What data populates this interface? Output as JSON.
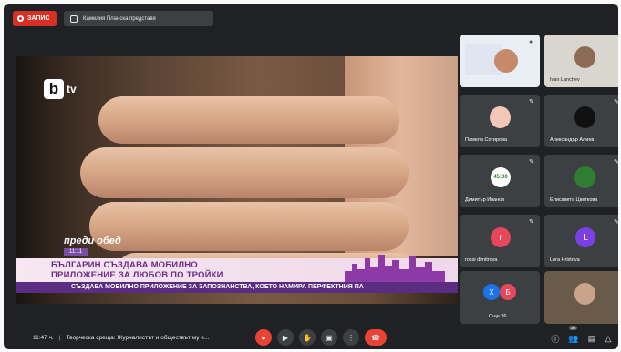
{
  "topbar": {
    "record_label": "ЗАПИС",
    "presenter_chip": "Камелия Планска представя"
  },
  "stage": {
    "channel_logo": "b",
    "channel_suffix": "tv",
    "show_name": "преди обед",
    "time_tag": "11:11",
    "headline_line1": "БЪЛГАРИН СЪЗДАВА МОБИЛНО",
    "headline_line2": "ПРИЛОЖЕНИЕ ЗА ЛЮБОВ ПО ТРОЙКИ",
    "ticker": "СЪЗДАВА МОБИЛНО ПРИЛОЖЕНИЕ ЗА ЗАПОЗНАНСТВА, КОЕТО НАМИРА ПЕРФЕКТНИЯ ПА"
  },
  "participants": [
    {
      "name": "",
      "kind": "screen"
    },
    {
      "name": "Ivan Lanchev",
      "kind": "photo"
    },
    {
      "name": "Памела Сотирова",
      "kind": "photo",
      "color": "#f2c6b8"
    },
    {
      "name": "Александър Алиев",
      "kind": "photo",
      "color": "#111111"
    },
    {
      "name": "Димитър Иванов",
      "kind": "badge",
      "label": "45:00",
      "color": "#ffffff"
    },
    {
      "name": "Елисавета Цветкова",
      "kind": "photo",
      "color": "#2e7d32"
    },
    {
      "name": "rossi dimitrova",
      "kind": "avatar",
      "label": "r",
      "color": "#e8475b"
    },
    {
      "name": "Lora Hristova",
      "kind": "avatar",
      "label": "L",
      "color": "#7b3fe4"
    },
    {
      "name": "Още 26",
      "kind": "group",
      "labels": [
        "Х",
        "Б"
      ],
      "colors": [
        "#1a73e8",
        "#e8475b"
      ]
    },
    {
      "name": "",
      "kind": "photo"
    }
  ],
  "bottombar": {
    "time": "11:47 ч.",
    "meeting_title": "Творческа среща: Журналистът и обществът му е...",
    "people_count": "36",
    "icons": [
      "mic-off-icon",
      "camera-icon",
      "hand-icon",
      "present-icon",
      "more-icon",
      "end-call-icon",
      "info-icon",
      "people-icon",
      "chat-icon",
      "activities-icon"
    ]
  }
}
